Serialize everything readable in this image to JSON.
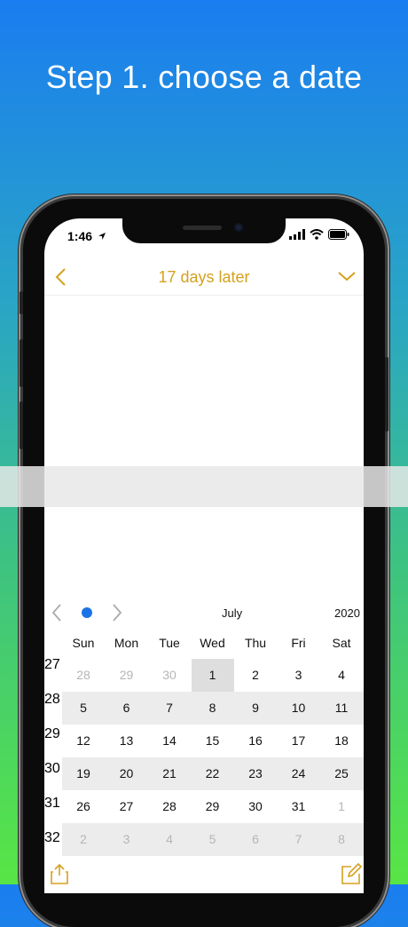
{
  "headline": "Step 1. choose a date",
  "status": {
    "time": "1:46"
  },
  "nav": {
    "title": "17  days later",
    "back_icon": "chevron-left-icon",
    "menu_icon": "chevron-down-icon"
  },
  "calendar": {
    "month": "July",
    "year": "2020",
    "weekdays": [
      "Sun",
      "Mon",
      "Tue",
      "Wed",
      "Thu",
      "Fri",
      "Sat"
    ],
    "weeks": [
      {
        "num": "27",
        "days": [
          "28",
          "29",
          "30",
          "1",
          "2",
          "3",
          "4"
        ]
      },
      {
        "num": "28",
        "days": [
          "5",
          "6",
          "7",
          "8",
          "9",
          "10",
          "11"
        ]
      },
      {
        "num": "29",
        "days": [
          "12",
          "13",
          "14",
          "15",
          "16",
          "17",
          "18"
        ]
      },
      {
        "num": "30",
        "days": [
          "19",
          "20",
          "21",
          "22",
          "23",
          "24",
          "25"
        ]
      },
      {
        "num": "31",
        "days": [
          "26",
          "27",
          "28",
          "29",
          "30",
          "31",
          "1"
        ]
      },
      {
        "num": "32",
        "days": [
          "2",
          "3",
          "4",
          "5",
          "6",
          "7",
          "8"
        ]
      }
    ]
  },
  "colors": {
    "accent": "#d5a11f",
    "dot": "#1b73e8",
    "muted_day": "#b5b5b5",
    "row_shade": "#ececec",
    "today_cell": "#dedede"
  }
}
